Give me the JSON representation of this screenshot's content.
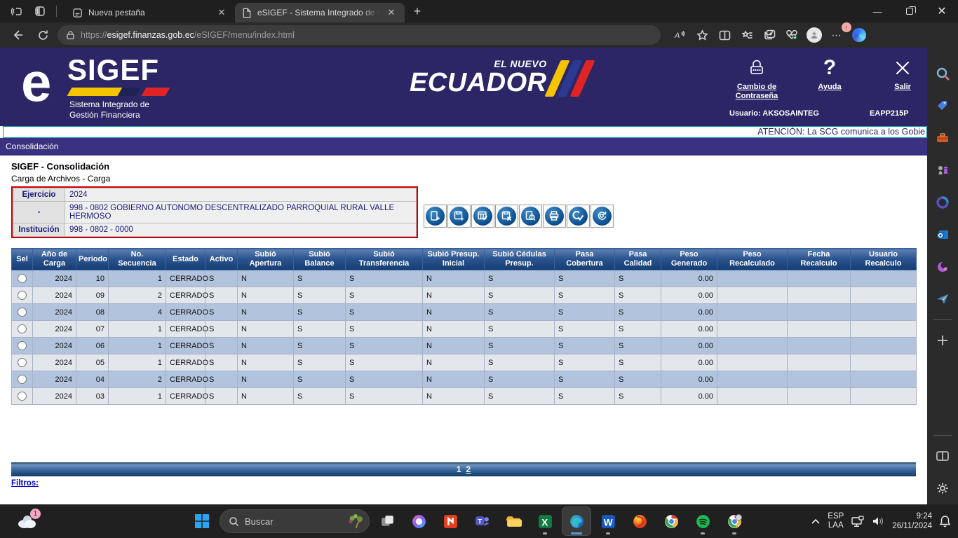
{
  "browser": {
    "tabs": [
      {
        "title": "Nueva pestaña",
        "active": false
      },
      {
        "title": "eSIGEF - Sistema Integrado de G",
        "active": true
      }
    ],
    "url": {
      "scheme": "https://",
      "host": "esigef.finanzas.gob.ec",
      "path": "/eSIGEF/menu/index.html"
    },
    "window_controls": [
      "minimize",
      "restore",
      "close"
    ]
  },
  "site_header": {
    "logo": {
      "e": "e",
      "name": "SIGEF",
      "subtitle_line1": "Sistema Integrado de",
      "subtitle_line2": "Gestión Financiera"
    },
    "brand": {
      "top": "EL NUEVO",
      "main": "ECUADOR"
    },
    "flag_colors": {
      "yellow": "#f5c400",
      "blue": "#2b3990",
      "red": "#e02424"
    },
    "actions": [
      {
        "id": "change-password",
        "label": "Cambio de Contraseña",
        "icon": "padlock-icon"
      },
      {
        "id": "help",
        "label": "Ayuda",
        "icon": "question-icon"
      },
      {
        "id": "exit",
        "label": "Salir",
        "icon": "close-x-icon"
      }
    ],
    "user": "Usuario: AKSOSAINTEG",
    "environment": "EAPP215P"
  },
  "marquee_text": "ATENCIÓN: La SCG comunica a los Gobie",
  "menubar": {
    "item": "Consolidación"
  },
  "main": {
    "title": "SIGEF - Consolidación",
    "subtitle": "Carga de Archivos - Carga",
    "info_rows": [
      {
        "label": "Ejercicio",
        "value": "2024"
      },
      {
        "label": "-",
        "value": "998 - 0802 GOBIERNO AUTONOMO DESCENTRALIZADO PARROQUIAL RURAL VALLE HERMOSO"
      },
      {
        "label": "Institución",
        "value": "998 - 0802 - 0000"
      }
    ],
    "toolbar_icons": [
      "new-record-icon",
      "save-record-icon",
      "validate-record-icon",
      "delete-record-icon",
      "preview-record-icon",
      "print-icon",
      "quality-check-icon",
      "reload-search-icon"
    ],
    "table": {
      "sel_header": "Sel",
      "columns": [
        "Año de Carga",
        "Periodo",
        "No. Secuencia",
        "Estado",
        "Activo",
        "Subió Apertura",
        "Subió Balance",
        "Subió Transferencia",
        "Subió Presup. Inicial",
        "Subió Cédulas Presup.",
        "Pasa Cobertura",
        "Pasa Calidad",
        "Peso Generado",
        "Peso Recalculado",
        "Fecha Recalculo",
        "Usuario Recalculo"
      ],
      "rows": [
        [
          "2024",
          "10",
          "1",
          "CERRADO",
          "S",
          "N",
          "S",
          "S",
          "N",
          "S",
          "S",
          "S",
          "0.00",
          "",
          "",
          ""
        ],
        [
          "2024",
          "09",
          "2",
          "CERRADO",
          "S",
          "N",
          "S",
          "S",
          "N",
          "S",
          "S",
          "S",
          "0.00",
          "",
          "",
          ""
        ],
        [
          "2024",
          "08",
          "4",
          "CERRADO",
          "S",
          "N",
          "S",
          "S",
          "N",
          "S",
          "S",
          "S",
          "0.00",
          "",
          "",
          ""
        ],
        [
          "2024",
          "07",
          "1",
          "CERRADO",
          "S",
          "N",
          "S",
          "S",
          "N",
          "S",
          "S",
          "S",
          "0.00",
          "",
          "",
          ""
        ],
        [
          "2024",
          "06",
          "1",
          "CERRADO",
          "S",
          "N",
          "S",
          "S",
          "N",
          "S",
          "S",
          "S",
          "0.00",
          "",
          "",
          ""
        ],
        [
          "2024",
          "05",
          "1",
          "CERRADO",
          "S",
          "N",
          "S",
          "S",
          "N",
          "S",
          "S",
          "S",
          "0.00",
          "",
          "",
          ""
        ],
        [
          "2024",
          "04",
          "2",
          "CERRADO",
          "S",
          "N",
          "S",
          "S",
          "N",
          "S",
          "S",
          "S",
          "0.00",
          "",
          "",
          ""
        ],
        [
          "2024",
          "03",
          "1",
          "CERRADO",
          "S",
          "N",
          "S",
          "S",
          "N",
          "S",
          "S",
          "S",
          "0.00",
          "",
          "",
          ""
        ]
      ],
      "pagination": [
        {
          "label": "1",
          "current": true
        },
        {
          "label": "2",
          "current": false
        }
      ],
      "filters_label": "Filtros:"
    }
  },
  "edge_sidebar_icons": [
    "search-icon",
    "shopping-icon",
    "tools-icon",
    "games-icon",
    "microsoft-365-icon",
    "outlook-icon",
    "designer-icon",
    "drop-icon",
    "divider",
    "add-icon",
    "spacer",
    "divider",
    "split-screen-icon",
    "settings-gear-icon"
  ],
  "taskbar": {
    "widget_badge": "1",
    "search_placeholder": "Buscar",
    "apps": [
      {
        "name": "task-view",
        "running": false
      },
      {
        "name": "copilot",
        "running": false
      },
      {
        "name": "nitro-pdf",
        "running": false
      },
      {
        "name": "teams",
        "running": false
      },
      {
        "name": "file-explorer",
        "running": false
      },
      {
        "name": "excel",
        "running": true
      },
      {
        "name": "edge",
        "running": true,
        "active": true
      },
      {
        "name": "word",
        "running": true
      },
      {
        "name": "firefox",
        "running": false
      },
      {
        "name": "chrome",
        "running": false
      },
      {
        "name": "spotify",
        "running": true
      },
      {
        "name": "chrome-profile",
        "running": true
      }
    ],
    "tray": {
      "lang_line1": "ESP",
      "lang_line2": "LAA",
      "time": "9:24",
      "date": "26/11/2024"
    }
  }
}
